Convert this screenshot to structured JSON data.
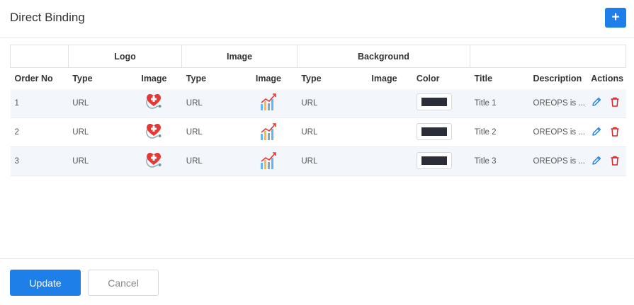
{
  "header": {
    "title": "Direct Binding",
    "add_label": "+"
  },
  "groups": {
    "logo": "Logo",
    "image": "Image",
    "background": "Background"
  },
  "columns": [
    "Order No",
    "Type",
    "Image",
    "Type",
    "Image",
    "Type",
    "Image",
    "Color",
    "Title",
    "Description",
    "Actions"
  ],
  "rows": [
    {
      "order": "1",
      "logo_type": "URL",
      "logo_image": "heart-stethoscope-icon",
      "image_type": "URL",
      "image_image": "chart-icon",
      "bg_type": "URL",
      "color": "#2b2d38",
      "title": "Title 1",
      "description": "OREOPS is ..."
    },
    {
      "order": "2",
      "logo_type": "URL",
      "logo_image": "heart-stethoscope-icon",
      "image_type": "URL",
      "image_image": "chart-icon",
      "bg_type": "URL",
      "color": "#2b2d38",
      "title": "Title 2",
      "description": "OREOPS is ..."
    },
    {
      "order": "3",
      "logo_type": "URL",
      "logo_image": "heart-stethoscope-icon",
      "image_type": "URL",
      "image_image": "chart-icon",
      "bg_type": "URL",
      "color": "#2b2d38",
      "title": "Title 3",
      "description": "OREOPS is ..."
    }
  ],
  "actions": {
    "edit_icon": "pencil-icon",
    "delete_icon": "trash-icon"
  },
  "footer": {
    "update_label": "Update",
    "cancel_label": "Cancel"
  },
  "colors": {
    "primary": "#1e7fe8",
    "delete": "#e02424",
    "edit": "#1e7fe8"
  }
}
